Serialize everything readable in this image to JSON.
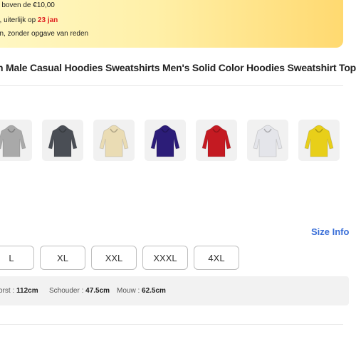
{
  "promo": {
    "line1": "n boven de €10,00",
    "line2_prefix": "n, uiterlijk op ",
    "line2_date": "23 jan",
    "line3": "en, zonder opgave van reden"
  },
  "product": {
    "title": "n Male Casual Hoodies Sweatshirts Men's Solid Color Hoodies Sweatshirt Tops"
  },
  "colors": [
    {
      "name": "gray",
      "hex": "#a9a9a9"
    },
    {
      "name": "dark-gray",
      "hex": "#4a4e55"
    },
    {
      "name": "beige",
      "hex": "#eadcb4"
    },
    {
      "name": "navy-purple",
      "hex": "#2c1d78"
    },
    {
      "name": "red",
      "hex": "#c41a22"
    },
    {
      "name": "white",
      "hex": "#e4e5ea"
    },
    {
      "name": "yellow",
      "hex": "#e8cf19"
    }
  ],
  "size_info_label": "Size Info",
  "sizes": [
    "L",
    "XL",
    "XXL",
    "XXXL",
    "4XL"
  ],
  "measurements": {
    "borst_label": "orst :",
    "borst_value": "112cm",
    "schouder_label": "Schouder :",
    "schouder_value": "47.5cm",
    "mouw_label": "Mouw :",
    "mouw_value": "62.5cm"
  }
}
